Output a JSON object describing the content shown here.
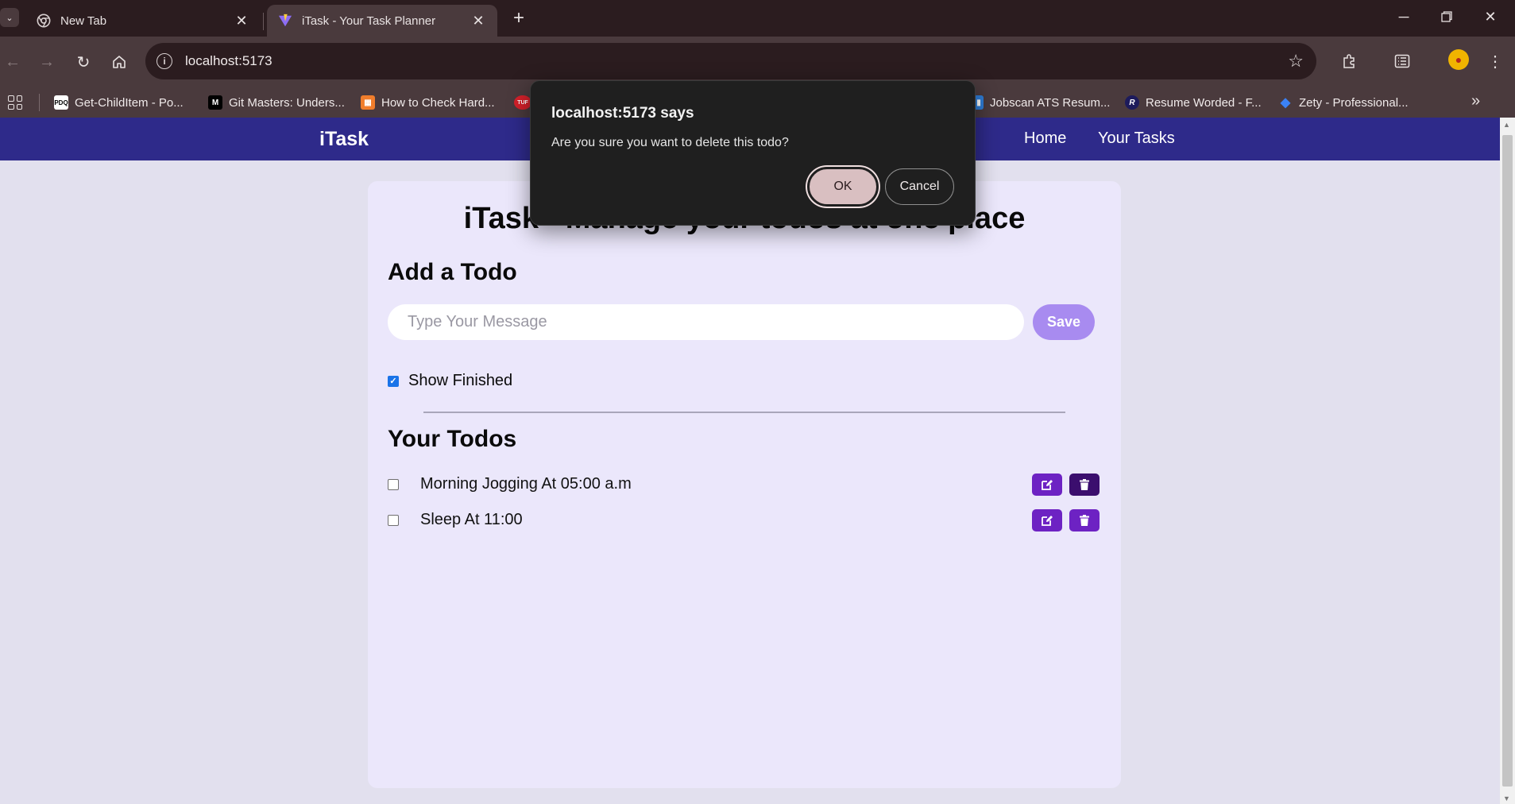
{
  "browser": {
    "tabs": [
      {
        "title": "New Tab",
        "active": false,
        "icon": "chrome-icon"
      },
      {
        "title": "iTask - Your Task Planner",
        "active": true,
        "icon": "vite-icon"
      }
    ],
    "url": "localhost:5173",
    "bookmarks": [
      {
        "label": "Get-ChildItem - Po...",
        "icon": "pdq-icon",
        "badge": "PDQ"
      },
      {
        "label": "Git Masters: Unders...",
        "icon": "medium-icon",
        "badge": "M"
      },
      {
        "label": "How to Check Hard...",
        "icon": "bookmark-icon",
        "badge": "▦"
      },
      {
        "label": "",
        "icon": "tuf-icon",
        "badge": "TUF"
      },
      {
        "label": "Jobscan ATS Resum...",
        "icon": "jobscan-icon",
        "badge": "▮"
      },
      {
        "label": "Resume Worded - F...",
        "icon": "resume-worded-icon",
        "badge": "R"
      },
      {
        "label": "Zety - Professional...",
        "icon": "zety-icon",
        "badge": "◆"
      }
    ]
  },
  "app": {
    "brand": "iTask",
    "nav_links": [
      "Home",
      "Your Tasks"
    ],
    "title": "iTask - Manage your todos at one place",
    "add_heading": "Add a Todo",
    "input_placeholder": "Type Your Message",
    "save_label": "Save",
    "show_finished_label": "Show Finished",
    "show_finished_checked": true,
    "todos_heading": "Your Todos",
    "todos": [
      {
        "text": "Morning Jogging At 05:00 a.m",
        "done": false
      },
      {
        "text": "Sleep At 11:00",
        "done": false
      }
    ],
    "colors": {
      "nav_bg": "#2e2a8a",
      "card_bg": "#ebe7fb",
      "button_purple": "#6d22c3",
      "save_button": "#a88bf0"
    }
  },
  "dialog": {
    "title": "localhost:5173 says",
    "message": "Are you sure you want to delete this todo?",
    "ok_label": "OK",
    "cancel_label": "Cancel"
  }
}
